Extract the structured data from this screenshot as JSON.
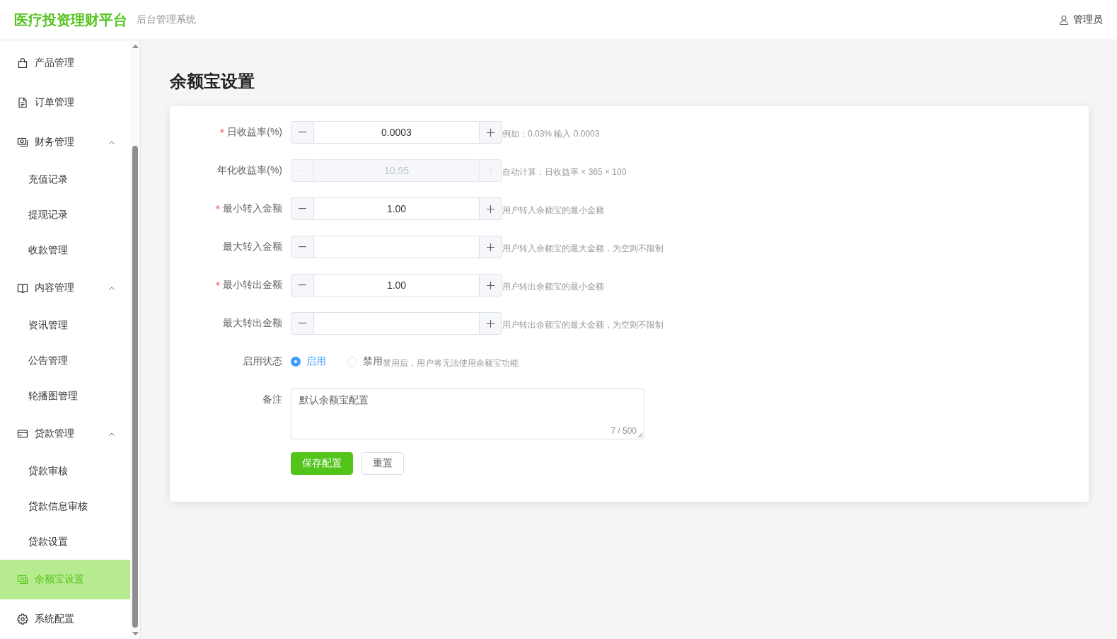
{
  "header": {
    "logo": "医疗投资理财平台",
    "subtitle": "后台管理系统",
    "user": "管理员"
  },
  "sidebar": {
    "items": [
      {
        "label": "产品管理",
        "selected": false
      },
      {
        "label": "订单管理",
        "selected": false
      },
      {
        "label": "财务管理",
        "selected": false,
        "expanded": true,
        "children": [
          {
            "label": "充值记录",
            "selected": false
          },
          {
            "label": "提现记录",
            "selected": false
          },
          {
            "label": "收款管理",
            "selected": false
          }
        ]
      },
      {
        "label": "内容管理",
        "selected": false,
        "expanded": true,
        "children": [
          {
            "label": "资讯管理",
            "selected": false
          },
          {
            "label": "公告管理",
            "selected": false
          },
          {
            "label": "轮播图管理",
            "selected": false
          }
        ]
      },
      {
        "label": "贷款管理",
        "selected": false,
        "expanded": true,
        "children": [
          {
            "label": "贷款审核",
            "selected": false
          },
          {
            "label": "贷款信息审核",
            "selected": false
          },
          {
            "label": "贷款设置",
            "selected": false
          }
        ]
      },
      {
        "label": "余额宝设置",
        "selected": true
      },
      {
        "label": "系统配置",
        "selected": false
      }
    ]
  },
  "page": {
    "title": "余额宝设置"
  },
  "form": {
    "fields": [
      {
        "kind": "number",
        "label": "日收益率(%)",
        "required": true,
        "disabled": false,
        "value": "0.0003",
        "hint": "例如：0.03% 输入 0.0003"
      },
      {
        "kind": "number",
        "label": "年化收益率(%)",
        "required": false,
        "disabled": true,
        "value": "10.95",
        "hint": "自动计算：日收益率 × 365 × 100"
      },
      {
        "kind": "number",
        "label": "最小转入金额",
        "required": true,
        "disabled": false,
        "value": "1.00",
        "hint": "用户转入余额宝的最小金额"
      },
      {
        "kind": "number",
        "label": "最大转入金额",
        "required": false,
        "disabled": false,
        "hint": "用户转入余额宝的最大金额，为空则不限制"
      },
      {
        "kind": "number",
        "label": "最小转出金额",
        "required": true,
        "disabled": false,
        "value": "1.00",
        "hint": "用户转出余额宝的最小金额"
      },
      {
        "kind": "number",
        "label": "最大转出金额",
        "required": false,
        "disabled": false,
        "hint": "用户转出余额宝的最大金额，为空则不限制"
      },
      {
        "kind": "radio",
        "label": "启用状态",
        "required": false,
        "disabled": false,
        "options": [
          {
            "label": "启用",
            "selected": true
          },
          {
            "label": "禁用",
            "selected": false
          }
        ],
        "hint": "禁用后，用户将无法使用余额宝功能"
      },
      {
        "kind": "textarea",
        "label": "备注",
        "required": false,
        "disabled": false,
        "value": "默认余额宝配置",
        "counter": "7 / 500"
      }
    ],
    "buttons": [
      {
        "label": "保存配置",
        "kind": "primary"
      },
      {
        "label": "重置",
        "kind": "default"
      }
    ]
  }
}
